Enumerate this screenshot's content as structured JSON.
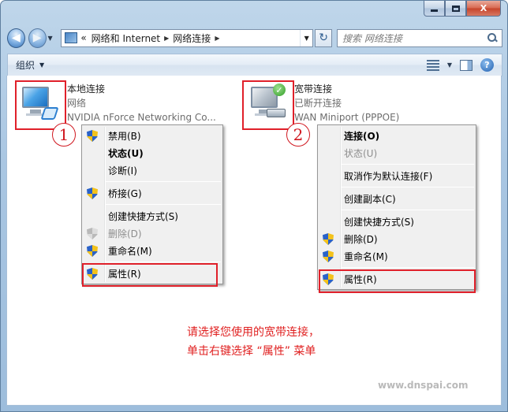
{
  "window": {
    "minimize_label": "",
    "maximize_label": "",
    "close_label": "X"
  },
  "nav": {
    "back_glyph": "◀",
    "forward_glyph": "▶",
    "breadcrumb_prefix": "«",
    "breadcrumb": [
      "网络和 Internet",
      "网络连接"
    ],
    "search_placeholder": "搜索 网络连接",
    "refresh_glyph": "↻"
  },
  "toolbar": {
    "organize_label": "组织",
    "help_label": "?"
  },
  "connections": [
    {
      "name": "本地连接",
      "status": "网络",
      "device": "NVIDIA nForce Networking Co..."
    },
    {
      "name": "宽带连接",
      "status": "已断开连接",
      "device": "WAN Miniport (PPPOE)"
    }
  ],
  "markers": [
    "1",
    "2"
  ],
  "menu_local": [
    {
      "label": "禁用(B)",
      "shield": true,
      "bold": false,
      "disabled": false
    },
    {
      "label": "状态(U)",
      "shield": false,
      "bold": true,
      "disabled": false
    },
    {
      "label": "诊断(I)",
      "shield": false,
      "bold": false,
      "disabled": false
    },
    {
      "label": "桥接(G)",
      "shield": true,
      "bold": false,
      "disabled": false
    },
    {
      "label": "创建快捷方式(S)",
      "shield": false,
      "bold": false,
      "disabled": false
    },
    {
      "label": "删除(D)",
      "shield": true,
      "bold": false,
      "disabled": true
    },
    {
      "label": "重命名(M)",
      "shield": true,
      "bold": false,
      "disabled": false
    },
    {
      "label": "属性(R)",
      "shield": true,
      "bold": false,
      "disabled": false
    }
  ],
  "menu_broadband": [
    {
      "label": "连接(O)",
      "shield": false,
      "bold": true,
      "disabled": false
    },
    {
      "label": "状态(U)",
      "shield": false,
      "bold": false,
      "disabled": true
    },
    {
      "label": "取消作为默认连接(F)",
      "shield": false,
      "bold": false,
      "disabled": false
    },
    {
      "label": "创建副本(C)",
      "shield": false,
      "bold": false,
      "disabled": false
    },
    {
      "label": "创建快捷方式(S)",
      "shield": false,
      "bold": false,
      "disabled": false
    },
    {
      "label": "删除(D)",
      "shield": true,
      "bold": false,
      "disabled": false
    },
    {
      "label": "重命名(M)",
      "shield": true,
      "bold": false,
      "disabled": false
    },
    {
      "label": "属性(R)",
      "shield": true,
      "bold": false,
      "disabled": false
    }
  ],
  "instruction": {
    "line1": "请选择您使用的宽带连接，",
    "line2": "单击右键选择 “属性” 菜单"
  },
  "watermark": "www.dnspai.com"
}
